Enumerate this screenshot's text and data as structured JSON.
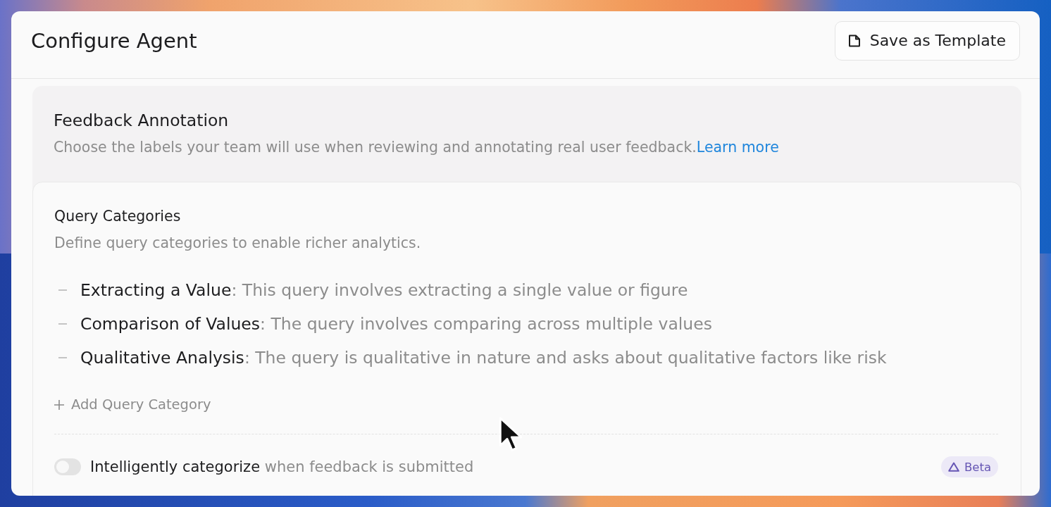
{
  "window": {
    "title": "Configure Agent",
    "actions": [
      {
        "label": "Save as Template"
      }
    ]
  },
  "section": {
    "title": "Feedback Annotation",
    "description": "Choose the labels your team will use when reviewing and annotating real user feedback.",
    "link": "Learn more",
    "card": {
      "title": "Query Categories",
      "description": "Define query categories to enable richer analytics.",
      "categories": [
        {
          "text": "**Extracting a Value**: This query involves extracting a single value or figure"
        },
        {
          "text": "**Comparison of Values**: The query involves comparing across multiple values"
        },
        {
          "text": "**Qualitative Analysis**: The query is qualitative in nature and asks about qualitative factors like risk"
        }
      ],
      "add_button": "Add Query Category",
      "toggle": {
        "on": false,
        "label": "**Intelligently categorize** when feedback is submitted",
        "badge": "Beta"
      }
    }
  }
}
